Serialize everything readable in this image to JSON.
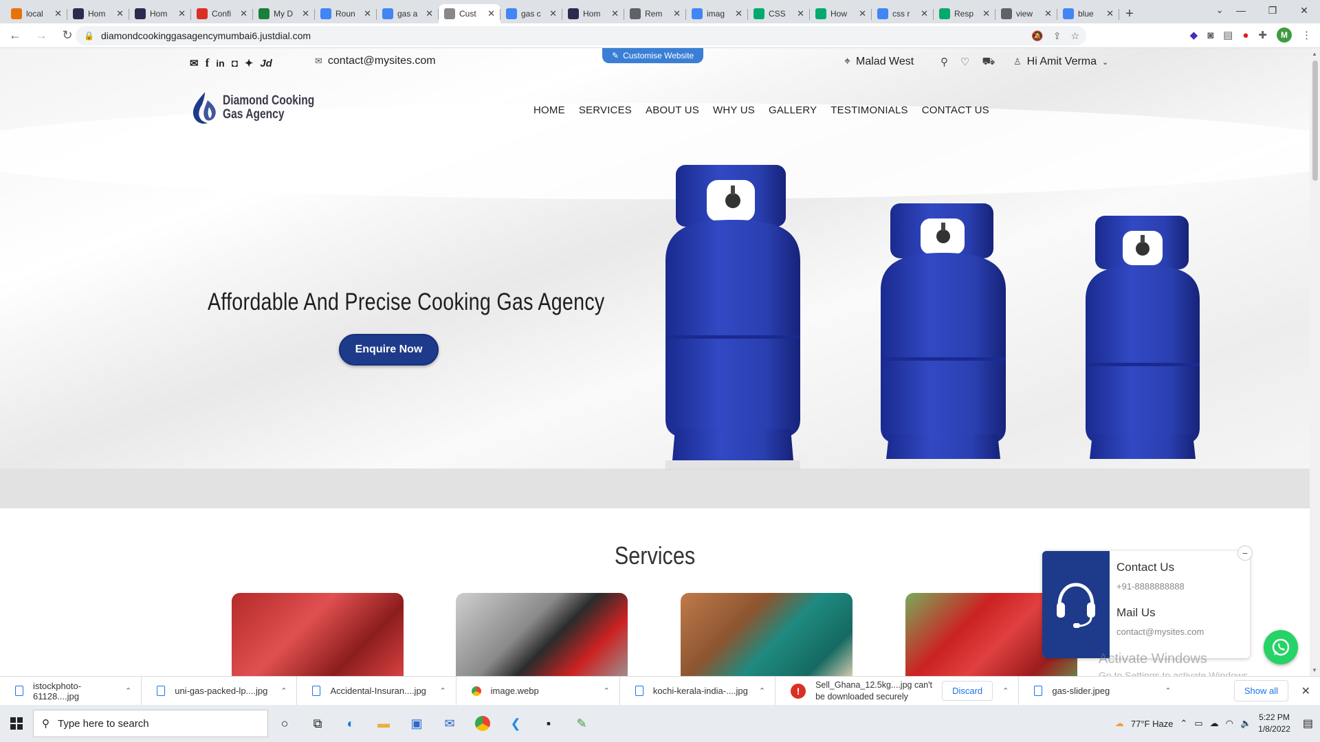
{
  "browser": {
    "tabs": [
      {
        "title": "local",
        "icon": "tab-icon-localhost",
        "color": "#e8710a"
      },
      {
        "title": "Hom",
        "icon": "tab-icon-b",
        "color": "#2b2b4f"
      },
      {
        "title": "Hom",
        "icon": "tab-icon-b",
        "color": "#2b2b4f"
      },
      {
        "title": "Confi",
        "icon": "tab-icon-gmail",
        "color": "#d93025"
      },
      {
        "title": "My D",
        "icon": "tab-icon-drive",
        "color": "#188038"
      },
      {
        "title": "Roun",
        "icon": "tab-icon-wave",
        "color": "#4285f4"
      },
      {
        "title": "gas a",
        "icon": "tab-icon-google",
        "color": "#4285f4"
      },
      {
        "title": "Cust",
        "icon": "tab-icon-jd",
        "color": "#888888"
      },
      {
        "title": "gas c",
        "icon": "tab-icon-google",
        "color": "#4285f4"
      },
      {
        "title": "Hom",
        "icon": "tab-icon-b",
        "color": "#2b2b4f"
      },
      {
        "title": "Rem",
        "icon": "tab-icon-gray",
        "color": "#5f6368"
      },
      {
        "title": "imag",
        "icon": "tab-icon-google",
        "color": "#4285f4"
      },
      {
        "title": "CSS",
        "icon": "tab-icon-w3",
        "color": "#04aa6d"
      },
      {
        "title": "How",
        "icon": "tab-icon-w3",
        "color": "#04aa6d"
      },
      {
        "title": "css r",
        "icon": "tab-icon-google",
        "color": "#4285f4"
      },
      {
        "title": "Resp",
        "icon": "tab-icon-w3",
        "color": "#04aa6d"
      },
      {
        "title": "view",
        "icon": "tab-icon-globe",
        "color": "#5f6368"
      },
      {
        "title": "blue",
        "icon": "tab-icon-google",
        "color": "#4285f4"
      }
    ],
    "active_tab": 7,
    "url": "diamondcookinggasagencymumbai6.justdial.com",
    "profile_initial": "M"
  },
  "site": {
    "topbar": {
      "social_jd": "Jd",
      "email": "contact@mysites.com",
      "customise_label": "Customise Website",
      "location": "Malad West",
      "user_greeting": "Hi Amit Verma"
    },
    "logo": {
      "line1": "Diamond Cooking",
      "line2": "Gas Agency"
    },
    "nav": [
      "HOME",
      "SERVICES",
      "ABOUT US",
      "WHY US",
      "GALLERY",
      "TESTIMONIALS",
      "CONTACT US"
    ],
    "hero": {
      "title": "Affordable And Precise Cooking Gas Agency",
      "cta": "Enquire Now",
      "cylinder_color": "#2a3fb0"
    },
    "services": {
      "title": "Services"
    },
    "contact_widget": {
      "contact_heading": "Contact Us",
      "phone": "+91-8888888888",
      "mail_heading": "Mail Us",
      "email": "contact@mysites.com"
    },
    "watermark": {
      "line1": "Activate Windows",
      "line2": "Go to Settings to activate Windows."
    }
  },
  "downloads": {
    "items": [
      {
        "name": "istockphoto-61128....jpg"
      },
      {
        "name": "uni-gas-packed-lp....jpg"
      },
      {
        "name": "Accidental-Insuran....jpg"
      },
      {
        "name": "image.webp"
      },
      {
        "name": "kochi-kerala-india-....jpg"
      }
    ],
    "warning": {
      "text": "Sell_Ghana_12.5kg....jpg can't be downloaded securely",
      "discard": "Discard"
    },
    "last": "gas-slider.jpeg",
    "show_all": "Show all"
  },
  "taskbar": {
    "search_placeholder": "Type here to search",
    "weather": "77°F  Haze",
    "time": "5:22 PM",
    "date": "1/8/2022"
  }
}
